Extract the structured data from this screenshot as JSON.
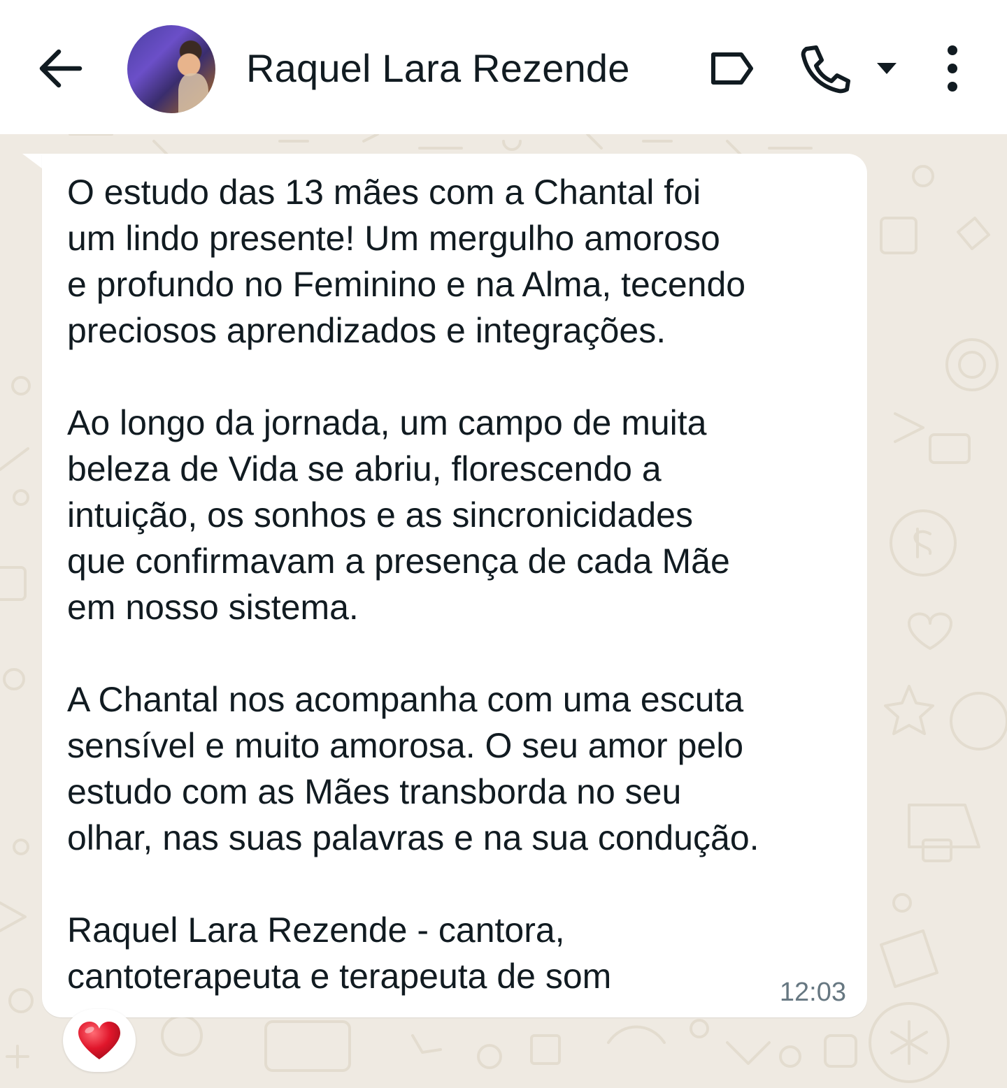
{
  "header": {
    "back_icon": "arrow-left-icon",
    "avatar_icon": "contact-avatar",
    "contact_name": "Raquel Lara Rezende",
    "label_icon": "label-icon",
    "call_icon": "phone-icon",
    "call_menu_icon": "caret-down-icon",
    "more_icon": "more-vertical-icon"
  },
  "message": {
    "text": "O estudo das 13 mães com a Chantal foi\num lindo presente! Um mergulho amoroso\ne profundo no Feminino e na Alma, tecendo\npreciosos aprendizados e integrações.\n\nAo longo da jornada, um campo de muita\nbeleza de Vida se abriu, florescendo a\nintuição, os sonhos e as sincronicidades\nque confirmavam a presença de cada Mãe\nem nosso sistema.\n\nA Chantal nos acompanha com uma escuta\nsensível e muito amorosa. O seu amor pelo\nestudo com as Mães transborda no seu\nolhar, nas suas palavras e na sua condução.\n\nRaquel Lara Rezende - cantora,\ncantoterapeuta e terapeuta de som",
    "time": "12:03",
    "reaction_icon": "red-heart-icon"
  },
  "colors": {
    "chat_background": "#efeae2",
    "bubble": "#ffffff",
    "text": "#111b21",
    "timestamp": "#667781",
    "header_icons": "#111b21",
    "heart": "#e0162b"
  }
}
